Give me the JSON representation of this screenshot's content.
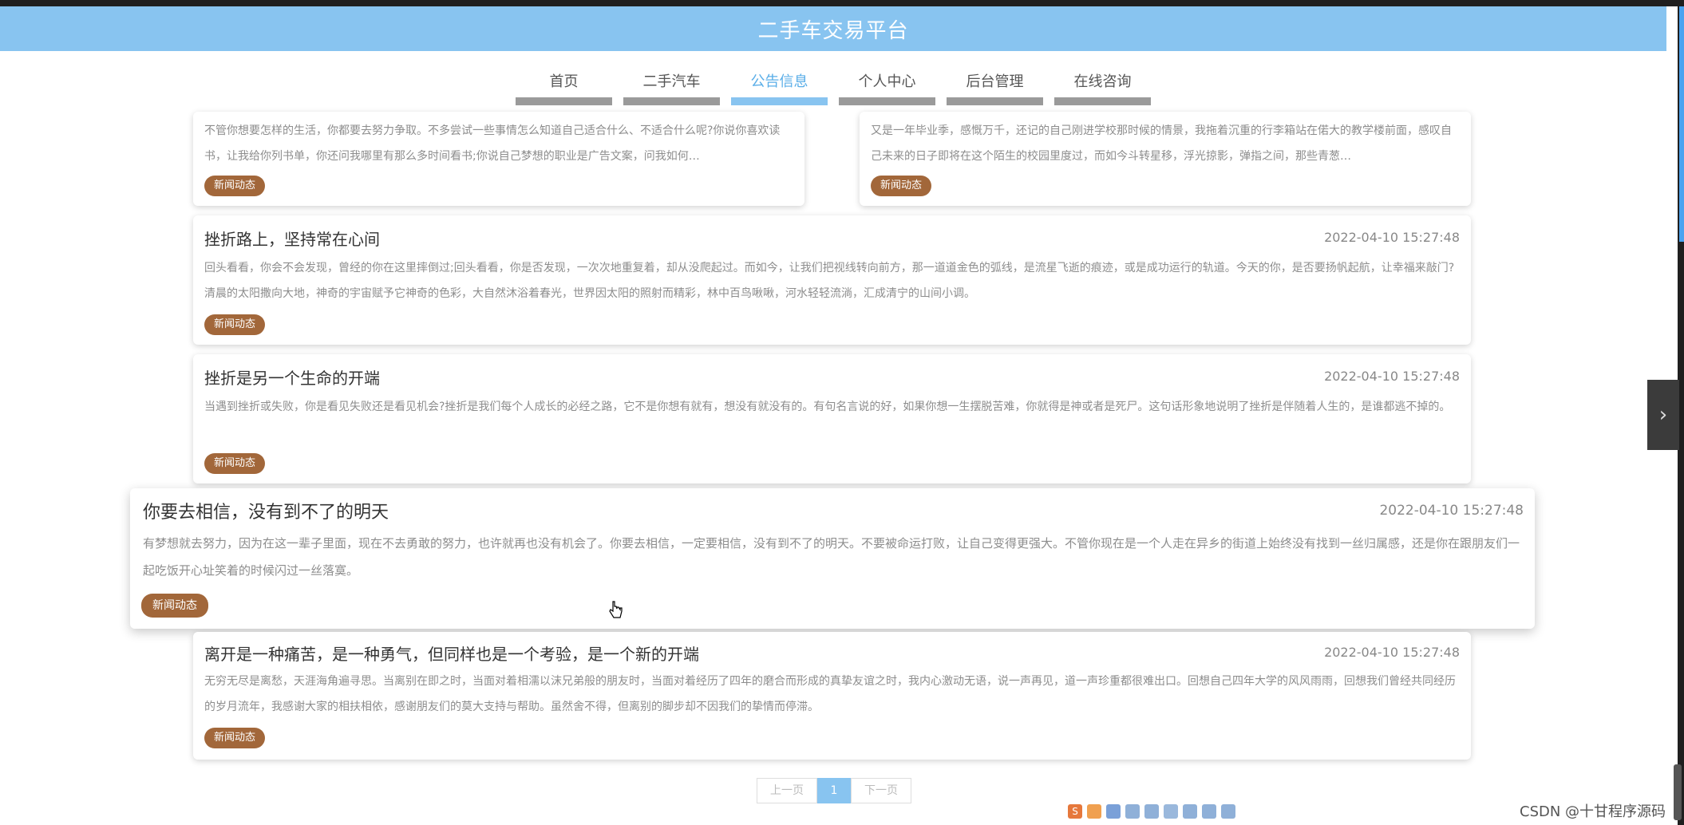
{
  "header": {
    "title": "二手车交易平台"
  },
  "nav": [
    {
      "label": "首页",
      "active": false
    },
    {
      "label": "二手汽车",
      "active": false
    },
    {
      "label": "公告信息",
      "active": true
    },
    {
      "label": "个人中心",
      "active": false
    },
    {
      "label": "后台管理",
      "active": false
    },
    {
      "label": "在线咨询",
      "active": false
    }
  ],
  "top_cards": [
    {
      "desc": "不管你想要怎样的生活，你都要去努力争取。不多尝试一些事情怎么知道自己适合什么、不适合什么呢?你说你喜欢读书，让我给你列书单，你还问我哪里有那么多时间看书;你说自己梦想的职业是广告文案，问我如何…",
      "tag": "新闻动态"
    },
    {
      "desc": "又是一年毕业季，感慨万千，还记的自己刚进学校那时候的情景，我拖着沉重的行李箱站在偌大的教学楼前面，感叹自己未来的日子即将在这个陌生的校园里度过，而如今斗转星移，浮光掠影，弹指之间，那些青葱…",
      "tag": "新闻动态"
    }
  ],
  "cards": [
    {
      "title": "挫折路上，坚持常在心间",
      "date": "2022-04-10 15:27:48",
      "desc": "回头看看，你会不会发现，曾经的你在这里摔倒过;回头看看，你是否发现，一次次地重复着，却从没爬起过。而如今，让我们把视线转向前方，那一道道金色的弧线，是流星飞逝的痕迹，或是成功运行的轨道。今天的你，是否要扬帆起航，让幸福来敲门?清晨的太阳撒向大地，神奇的宇宙赋予它神奇的色彩，大自然沐浴着春光，世界因太阳的照射而精彩，林中百鸟啾啾，河水轻轻流淌，汇成清宁的山间小调。",
      "tag": "新闻动态"
    },
    {
      "title": "挫折是另一个生命的开端",
      "date": "2022-04-10 15:27:48",
      "desc": "当遇到挫折或失败，你是看见失败还是看见机会?挫折是我们每个人成长的必经之路，它不是你想有就有，想没有就没有的。有句名言说的好，如果你想一生摆脱苦难，你就得是神或者是死尸。这句话形象地说明了挫折是伴随着人生的，是谁都逃不掉的。",
      "tag": "新闻动态"
    },
    {
      "title": "你要去相信，没有到不了的明天",
      "date": "2022-04-10 15:27:48",
      "desc": "有梦想就去努力，因为在这一辈子里面，现在不去勇敢的努力，也许就再也没有机会了。你要去相信，一定要相信，没有到不了的明天。不要被命运打败，让自己变得更强大。不管你现在是一个人走在异乡的街道上始终没有找到一丝归属感，还是你在跟朋友们一起吃饭开心址笑着的时候闪过一丝落寞。",
      "tag": "新闻动态"
    },
    {
      "title": "离开是一种痛苦，是一种勇气，但同样也是一个考验，是一个新的开端",
      "date": "2022-04-10 15:27:48",
      "desc": "无穷无尽是离愁，天涯海角遍寻思。当离别在即之时，当面对着相濡以沫兄弟般的朋友时，当面对着经历了四年的磨合而形成的真挚友谊之时，我内心激动无语，说一声再见，道一声珍重都很难出口。回想自己四年大学的风风雨雨，回想我们曾经共同经历的岁月流年，我感谢大家的相扶相依，感谢朋友们的莫大支持与帮助。虽然舍不得，但离别的脚步却不因我们的挚情而停滞。",
      "tag": "新闻动态"
    }
  ],
  "pager": {
    "prev": "上一页",
    "current": "1",
    "next": "下一页"
  },
  "watermark": "CSDN @十甘程序源码"
}
